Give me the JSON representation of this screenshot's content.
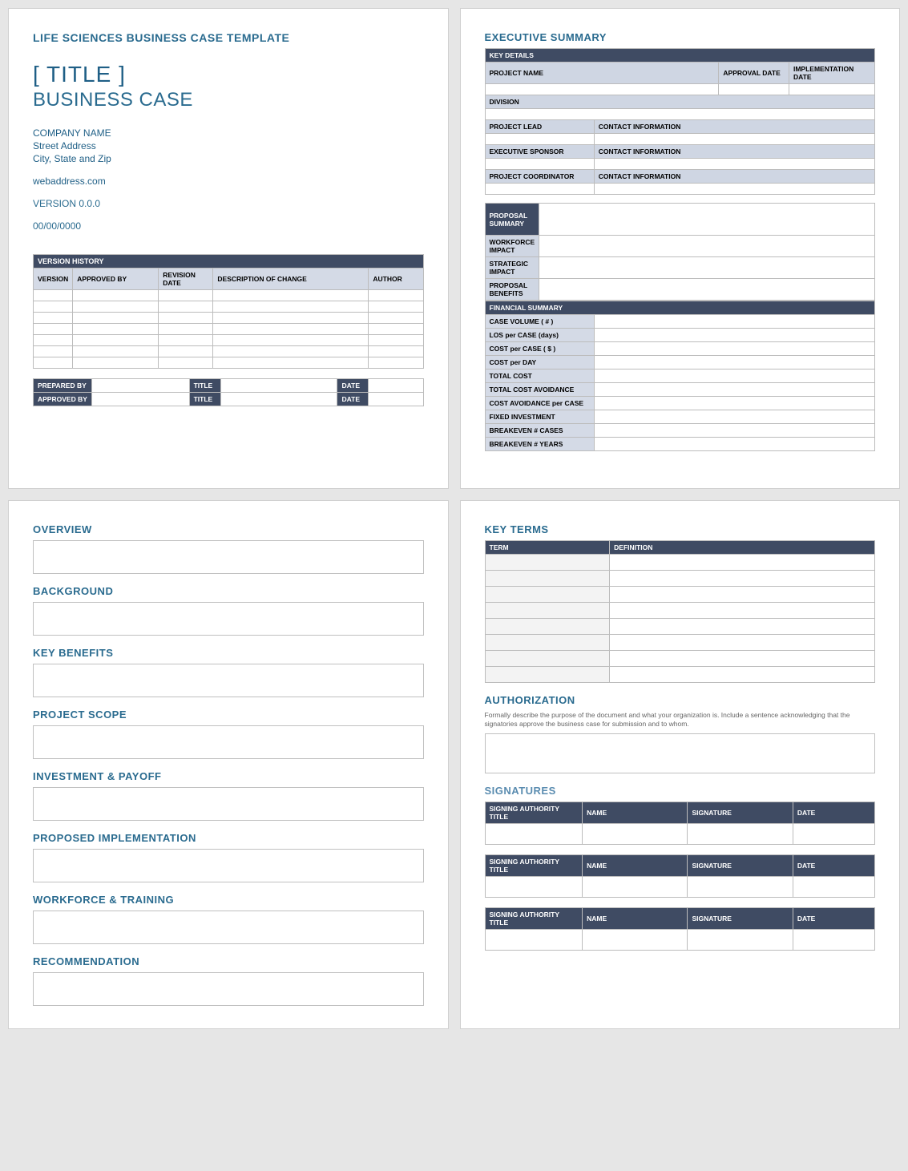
{
  "page1": {
    "templateName": "LIFE SCIENCES BUSINESS CASE TEMPLATE",
    "title": "[ TITLE ]",
    "subtitle": "BUSINESS CASE",
    "companyName": "COMPANY NAME",
    "street": "Street Address",
    "cityLine": "City, State and Zip",
    "web": "webaddress.com",
    "version": "VERSION 0.0.0",
    "date": "00/00/0000",
    "versionHistoryTitle": "VERSION HISTORY",
    "vh": {
      "version": "VERSION",
      "approvedBy": "APPROVED BY",
      "revisionDate": "REVISION DATE",
      "desc": "DESCRIPTION OF CHANGE",
      "author": "AUTHOR"
    },
    "sign": {
      "preparedBy": "PREPARED BY",
      "approvedBy": "APPROVED BY",
      "title": "TITLE",
      "date": "DATE"
    }
  },
  "page2": {
    "title": "EXECUTIVE SUMMARY",
    "keyDetails": "KEY DETAILS",
    "projectName": "PROJECT NAME",
    "approvalDate": "APPROVAL DATE",
    "implDate": "IMPLEMENTATION DATE",
    "division": "DIVISION",
    "projectLead": "PROJECT LEAD",
    "contactInfo": "CONTACT INFORMATION",
    "execSponsor": "EXECUTIVE SPONSOR",
    "projCoord": "PROJECT COORDINATOR",
    "propSummary": "PROPOSAL SUMMARY",
    "workforce": "WORKFORCE IMPACT",
    "strategic": "STRATEGIC IMPACT",
    "benefits": "PROPOSAL BENEFITS",
    "finSummary": "FINANCIAL SUMMARY",
    "fin": {
      "caseVol": "CASE VOLUME ( # )",
      "los": "LOS per CASE (days)",
      "costCase": "COST per CASE ( $ )",
      "costDay": "COST per DAY",
      "totalCost": "TOTAL COST",
      "tca": "TOTAL COST AVOIDANCE",
      "cac": "COST AVOIDANCE per CASE",
      "fixed": "FIXED INVESTMENT",
      "beCases": "BREAKEVEN # CASES",
      "beYears": "BREAKEVEN # YEARS"
    }
  },
  "page3": {
    "overview": "OVERVIEW",
    "background": "BACKGROUND",
    "keyBenefits": "KEY BENEFITS",
    "scope": "PROJECT SCOPE",
    "invest": "INVESTMENT & PAYOFF",
    "impl": "PROPOSED IMPLEMENTATION",
    "workforce": "WORKFORCE & TRAINING",
    "rec": "RECOMMENDATION"
  },
  "page4": {
    "keyTerms": "KEY TERMS",
    "term": "TERM",
    "definition": "DEFINITION",
    "auth": "AUTHORIZATION",
    "authNote": "Formally describe the purpose of the document and what your organization is. Include a sentence acknowledging that the signatories approve the business case for submission and to whom.",
    "signatures": "SIGNATURES",
    "sig": {
      "authTitle": "SIGNING AUTHORITY TITLE",
      "name": "NAME",
      "signature": "SIGNATURE",
      "date": "DATE"
    }
  }
}
